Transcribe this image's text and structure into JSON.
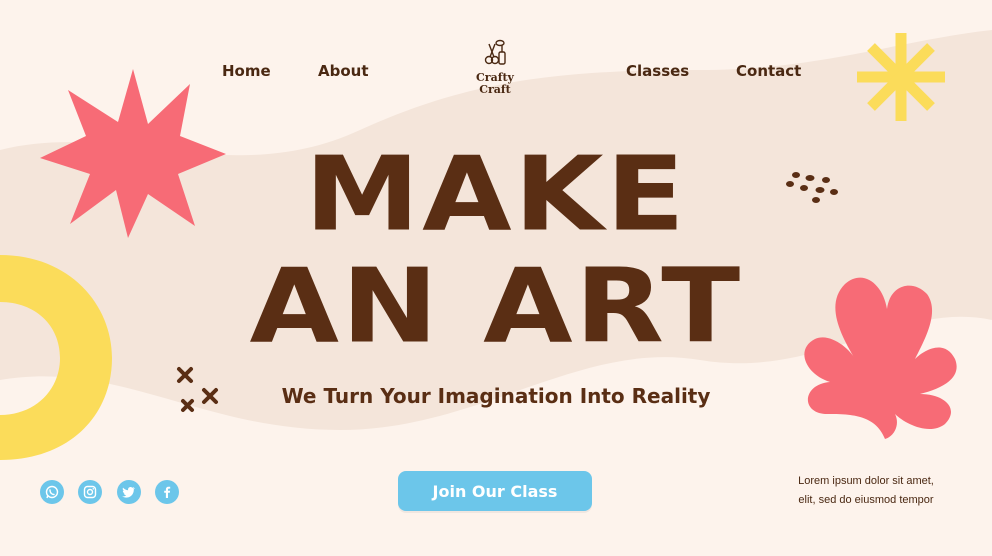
{
  "nav": {
    "home": "Home",
    "about": "About",
    "classes": "Classes",
    "contact": "Contact"
  },
  "logo": {
    "line1": "Crafty",
    "line2": "Craft"
  },
  "hero": {
    "headline_line1": "MAKE",
    "headline_line2": "AN ART",
    "tagline": "We Turn Your Imagination Into Reality",
    "cta_label": "Join Our Class"
  },
  "footer": {
    "lorem_line1": "Lorem ipsum dolor sit amet,",
    "lorem_line2": "elit, sed do eiusmod tempor"
  },
  "social": [
    "whatsapp-icon",
    "instagram-icon",
    "twitter-icon",
    "facebook-icon"
  ],
  "colors": {
    "background": "#fdf3ec",
    "wave": "#f4e5da",
    "brown": "#5a2e14",
    "coral": "#f76b76",
    "yellow": "#fbdc5a",
    "sky": "#6cc6ea"
  }
}
